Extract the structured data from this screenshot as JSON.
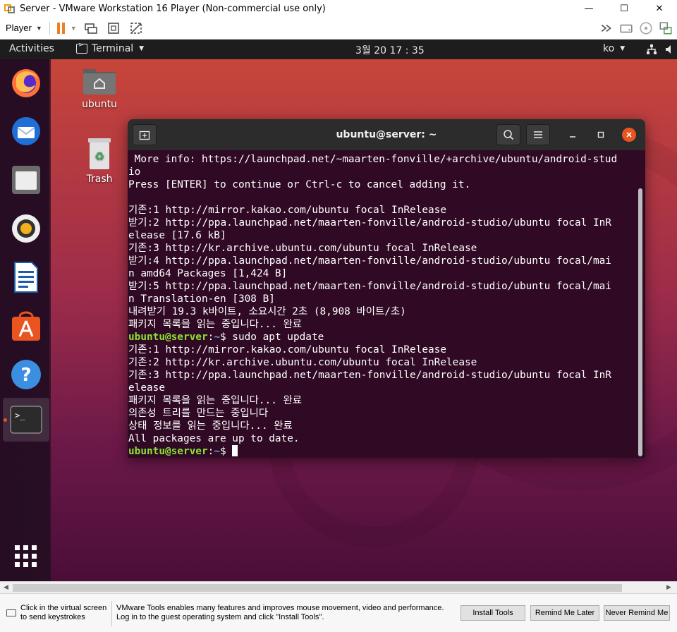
{
  "host": {
    "title": "Server - VMware Workstation 16 Player (Non-commercial use only)",
    "controls": {
      "minimize": "—",
      "maximize": "☐",
      "close": "✕"
    },
    "toolbar": {
      "player_label": "Player"
    }
  },
  "ubuntu": {
    "top_bar": {
      "activities": "Activities",
      "app_menu": "Terminal",
      "clock": "3월 20  17 : 35",
      "input_lang": "ko"
    },
    "desktop_icons": [
      {
        "label": "ubuntu"
      },
      {
        "label": "Trash"
      }
    ]
  },
  "terminal": {
    "title": "ubuntu@server: ~",
    "lines": [
      {
        "text": " More info: https://launchpad.net/~maarten-fonville/+archive/ubuntu/android-stud"
      },
      {
        "text": "io"
      },
      {
        "text": "Press [ENTER] to continue or Ctrl-c to cancel adding it."
      },
      {
        "text": ""
      },
      {
        "text": "기존:1 http://mirror.kakao.com/ubuntu focal InRelease"
      },
      {
        "text": "받기:2 http://ppa.launchpad.net/maarten-fonville/android-studio/ubuntu focal InR"
      },
      {
        "text": "elease [17.6 kB]"
      },
      {
        "text": "기존:3 http://kr.archive.ubuntu.com/ubuntu focal InRelease"
      },
      {
        "text": "받기:4 http://ppa.launchpad.net/maarten-fonville/android-studio/ubuntu focal/mai"
      },
      {
        "text": "n amd64 Packages [1,424 B]"
      },
      {
        "text": "받기:5 http://ppa.launchpad.net/maarten-fonville/android-studio/ubuntu focal/mai"
      },
      {
        "text": "n Translation-en [308 B]"
      },
      {
        "text": "내려받기 19.3 k바이트, 소요시간 2초 (8,908 바이트/초)"
      },
      {
        "text": "패키지 목록을 읽는 중입니다... 완료"
      },
      {
        "user": "ubuntu@server",
        "path": "~",
        "cmd": "$ sudo apt update"
      },
      {
        "text": "기존:1 http://mirror.kakao.com/ubuntu focal InRelease"
      },
      {
        "text": "기존:2 http://kr.archive.ubuntu.com/ubuntu focal InRelease"
      },
      {
        "text": "기존:3 http://ppa.launchpad.net/maarten-fonville/android-studio/ubuntu focal InR"
      },
      {
        "text": "elease"
      },
      {
        "text": "패키지 목록을 읽는 중입니다... 완료"
      },
      {
        "text": "의존성 트리를 만드는 중입니다"
      },
      {
        "text": "상태 정보를 읽는 중입니다... 완료"
      },
      {
        "text": "All packages are up to date."
      },
      {
        "user": "ubuntu@server",
        "path": "~",
        "cmd": "$ ",
        "cursor": true
      }
    ]
  },
  "notice": {
    "click_hint": "Click in the virtual screen to send keystrokes",
    "message": "VMware Tools enables many features and improves mouse movement, video and performance. Log in to the guest operating system and click \"Install Tools\".",
    "install_button": "Install Tools",
    "remind_button": "Remind Me Later",
    "never_button": "Never Remind Me"
  }
}
